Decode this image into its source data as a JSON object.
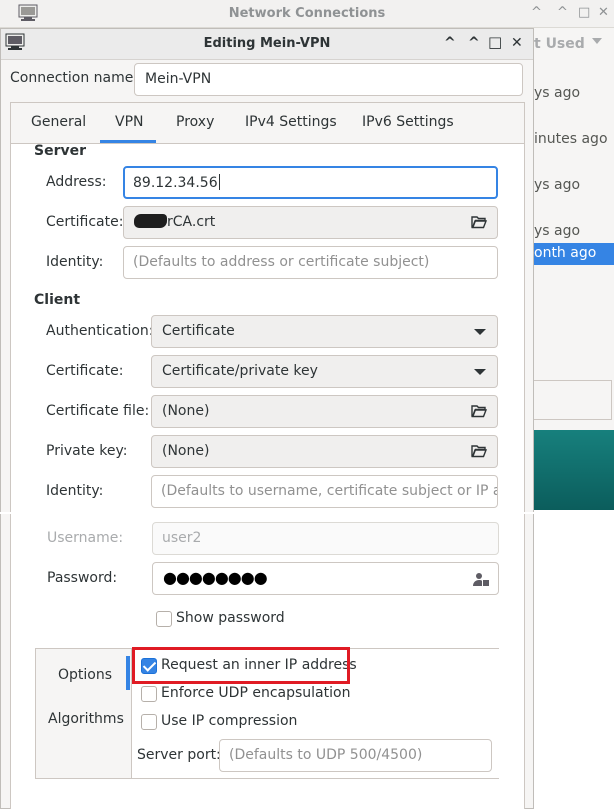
{
  "background_window": {
    "title": "Network Connections",
    "column_header": "t Used",
    "rows": [
      "ys ago",
      "inutes ago",
      "ys ago",
      "ys ago",
      "onth ago"
    ]
  },
  "dialog": {
    "title": "Editing Mein-VPN",
    "controls": {
      "minimize": "^",
      "restore": "^",
      "maximize": "□",
      "close": "✕"
    }
  },
  "connection_name": {
    "label": "Connection name",
    "value": "Mein-VPN"
  },
  "tabs": [
    {
      "label": "General"
    },
    {
      "label": "VPN"
    },
    {
      "label": "Proxy"
    },
    {
      "label": "IPv4 Settings"
    },
    {
      "label": "IPv6 Settings"
    }
  ],
  "server": {
    "heading": "Server",
    "address_label": "Address:",
    "address_value": "89.12.34.56",
    "certificate_label": "Certificate:",
    "certificate_value": "rCA.crt",
    "identity_label": "Identity:",
    "identity_placeholder": "(Defaults to address or certificate subject)"
  },
  "client": {
    "heading": "Client",
    "auth_label": "Authentication:",
    "auth_value": "Certificate",
    "cert_label": "Certificate:",
    "cert_value": "Certificate/private key",
    "cert_file_label": "Certificate file:",
    "cert_file_value": "(None)",
    "private_key_label": "Private key:",
    "private_key_value": "(None)",
    "identity_label": "Identity:",
    "identity_placeholder": "(Defaults to username, certificate subject or IP a…",
    "username_label": "Username:",
    "username_value": "user2",
    "password_label": "Password:",
    "password_value": "●●●●●●●●",
    "show_password_label": "Show password"
  },
  "options": {
    "sidebar": [
      "Options",
      "Algorithms"
    ],
    "request_inner_ip_label": "Request an inner IP address",
    "request_inner_ip_checked": true,
    "enforce_udp_label": "Enforce UDP encapsulation",
    "enforce_udp_checked": false,
    "ip_compression_label": "Use IP compression",
    "ip_compression_checked": false,
    "server_port_label": "Server port:",
    "server_port_placeholder": "(Defaults to UDP 500/4500)"
  },
  "colors": {
    "accent": "#3584e4",
    "highlight": "#e01b24",
    "teal": "#0f6e6c"
  }
}
